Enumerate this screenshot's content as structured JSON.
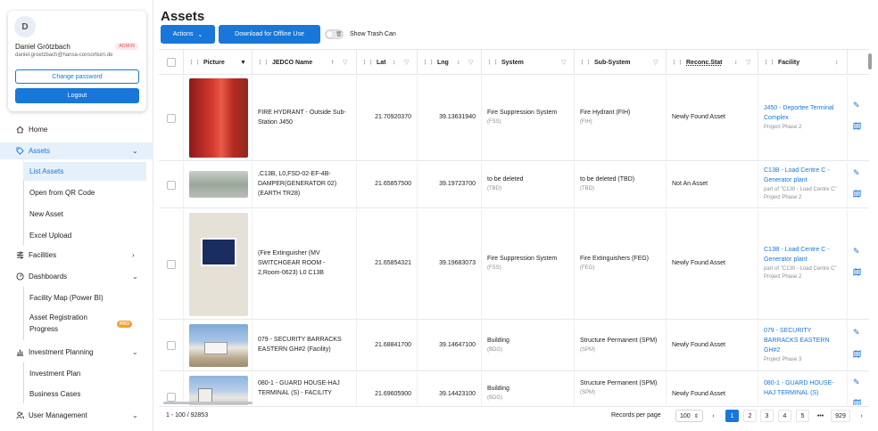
{
  "user": {
    "avatar_initial": "D",
    "name": "Daniel Grötzbach",
    "role_badge": "ADMIN",
    "email": "daniel.groetzbach@hansa-consortium.de",
    "change_password_label": "Change password",
    "logout_label": "Logout"
  },
  "nav": {
    "home": "Home",
    "assets": "Assets",
    "list_assets": "List Assets",
    "open_from_qr": "Open from QR Code",
    "new_asset": "New Asset",
    "excel_upload": "Excel Upload",
    "facilities": "Facilities",
    "dashboards": "Dashboards",
    "facility_map": "Facility Map (Power BI)",
    "asset_registration_progress": "Asset Registration Progress",
    "pro_badge": "PRO",
    "investment_planning": "Investment Planning",
    "investment_plan": "Investment Plan",
    "business_cases": "Business Cases",
    "user_management": "User Management"
  },
  "page": {
    "title": "Assets",
    "actions_label": "Actions",
    "download_label": "Download for Offline Use",
    "show_trash_label": "Show Trash Can"
  },
  "columns": {
    "picture": "Picture",
    "jedco_name": "JEDCO Name",
    "lat": "Lat",
    "lng": "Lng",
    "system": "System",
    "sub_system": "Sub-System",
    "reconc_stat": "Reconc.Stat",
    "facility": "Facility"
  },
  "rows": [
    {
      "name": "FIRE HYDRANT - Outside Sub-Station J450",
      "lat": "21.70920370",
      "lng": "39.13631940",
      "system": "Fire Suppression System",
      "system_code": "(FSS)",
      "subsystem": "Fire Hydrant (FIH)",
      "subsystem_code": "(FIH)",
      "reconc": "Newly Found Asset",
      "facility": "J450 - Deportee Terminal Complex",
      "facility_sub": "",
      "project": "Project Phase 2"
    },
    {
      "name": ",C13B, L0,FSD-02-EF-4B-DAMPER(GENERATOR 02)(EARTH TR28)",
      "lat": "21.65857500",
      "lng": "39.19723700",
      "system": "to be deleted",
      "system_code": "(TBD)",
      "subsystem": "to be deleted (TBD)",
      "subsystem_code": "(TBD)",
      "reconc": "Not An Asset",
      "facility": "C13B - Load Centre C - Generator plant",
      "facility_sub": "part of \"C130 - Load Centre C\"",
      "project": "Project Phase 2"
    },
    {
      "name": "(Fire Extinguisher (MV SWITCHGEAR ROOM - 2,Room-0623) L0 C13B",
      "lat": "21.65854321",
      "lng": "39.19683073",
      "system": "Fire Suppression System",
      "system_code": "(FSS)",
      "subsystem": "Fire Extinguishers (FEG)",
      "subsystem_code": "(FEG)",
      "reconc": "Newly Found Asset",
      "facility": "C13B - Load Centre C - Generator plant",
      "facility_sub": "part of \"C130 - Load Centre C\"",
      "project": "Project Phase 2"
    },
    {
      "name": "079 - SECURITY BARRACKS EASTERN GH#2 (Facility)",
      "lat": "21.68841700",
      "lng": "39.14647100",
      "system": "Building",
      "system_code": "(BDG)",
      "subsystem": "Structure Permanent (SPM)",
      "subsystem_code": "(SPM)",
      "reconc": "Newly Found Asset",
      "facility": "079 - SECURITY BARRACKS EASTERN GH#2",
      "facility_sub": "",
      "project": "Project Phase 3"
    },
    {
      "name": "080-1 - GUARD HOUSE-HAJ TERMINAL (S) - FACILITY",
      "lat": "21.69605900",
      "lng": "39.14423100",
      "system": "Building",
      "system_code": "(BDG)",
      "subsystem": "Structure Permanent (SPM)",
      "subsystem_code": "(SPM)",
      "reconc": "Newly Found Asset",
      "facility": "080-1 - GUARD HOUSE-HAJ TERMINAL (S)",
      "facility_sub": "",
      "project": ""
    }
  ],
  "footer": {
    "range": "1 - 100 / 92853",
    "records_per_page_label": "Records per page",
    "records_per_page": "100",
    "pages": [
      "1",
      "2",
      "3",
      "4",
      "5",
      "•••",
      "929"
    ],
    "current_page": "1"
  },
  "colors": {
    "accent": "#1877d8",
    "active_bg": "#e6f0fb",
    "pro_badge": "#f0a030",
    "admin_badge": "#d9534f"
  },
  "icons": [
    "home-icon",
    "tag-icon",
    "facilities-icon",
    "dashboard-icon",
    "chart-icon",
    "users-icon",
    "chevron-down-icon",
    "chevron-right-icon",
    "edit-icon",
    "map-icon",
    "trash-icon",
    "drag-handle-icon",
    "sort-icon",
    "filter-icon"
  ]
}
